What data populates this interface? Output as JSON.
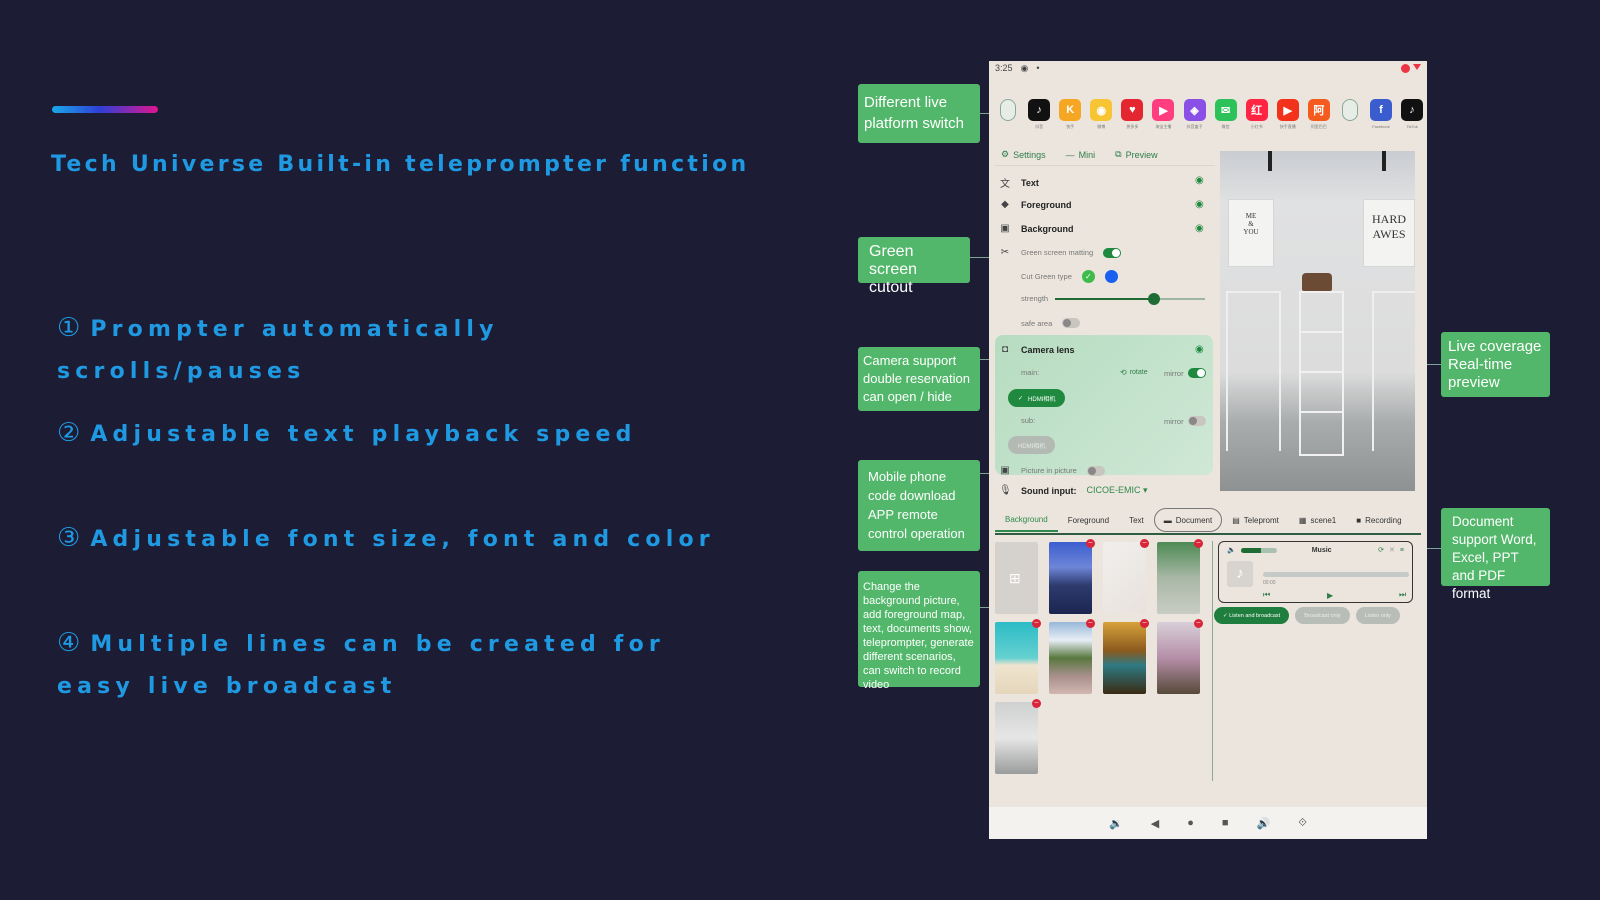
{
  "slide": {
    "title": "Tech Universe Built-in teleprompter function",
    "accent_gradient": [
      "#19a9ea",
      "#2e3fd6",
      "#e0158e"
    ],
    "text_color": "#1f9ae2",
    "background": "#1c1c35",
    "features": [
      {
        "num": "①",
        "text": "Prompter automatically scrolls/pauses"
      },
      {
        "num": "②",
        "text": "Adjustable text playback speed"
      },
      {
        "num": "③",
        "text": "Adjustable font size, font and color"
      },
      {
        "num": "④",
        "text": "Multiple lines can be created for easy live broadcast"
      }
    ]
  },
  "callouts": {
    "platform": "Different live platform switch",
    "green": "Green screen cutout",
    "camera": "Camera support double reservation can open / hide",
    "mobile": "Mobile phone code download APP remote control operation",
    "change": "Change the background picture, add foreground map, text, documents show, teleprompter, generate different scenarios, can switch to record video",
    "preview": "Live coverage Real-time preview",
    "document": "Document support Word, Excel, PPT and PDF format",
    "color": "#52b76a"
  },
  "app": {
    "status_time": "3:25",
    "platforms": [
      {
        "name": "custom-1",
        "label": "",
        "color": "pill",
        "glyph": "Other"
      },
      {
        "name": "douyin",
        "label": "抖音",
        "color": "#111111",
        "glyph": "♪"
      },
      {
        "name": "kuaishou",
        "label": "快手",
        "color": "#f5a623",
        "glyph": "K"
      },
      {
        "name": "weibo",
        "label": "微博",
        "color": "#f7c533",
        "glyph": "◉"
      },
      {
        "name": "pinduoduo",
        "label": "拼多多",
        "color": "#e3262f",
        "glyph": "♥"
      },
      {
        "name": "taobao-live",
        "label": "淘宝主播",
        "color": "#ff3d7f",
        "glyph": "▶"
      },
      {
        "name": "douyin-box",
        "label": "抖音盒子",
        "color": "#8a4fe6",
        "glyph": "◈"
      },
      {
        "name": "wechat",
        "label": "微信",
        "color": "#2dc15a",
        "glyph": "✉"
      },
      {
        "name": "xiaohongshu",
        "label": "小红书",
        "color": "#ff2442",
        "glyph": "红"
      },
      {
        "name": "kuaishou-live",
        "label": "快手直播",
        "color": "#f2321b",
        "glyph": "▶"
      },
      {
        "name": "aliexpress",
        "label": "阿里巴巴",
        "color": "#f55a1f",
        "glyph": "阿"
      },
      {
        "name": "custom-2",
        "label": "",
        "color": "pill",
        "glyph": "Other"
      },
      {
        "name": "facebook",
        "label": "Facebook",
        "color": "#3b5ccf",
        "glyph": "f"
      },
      {
        "name": "tiktok",
        "label": "TikTok",
        "color": "#111111",
        "glyph": "♪"
      }
    ],
    "toolbar": {
      "settings": "Settings",
      "mini": "Mini",
      "preview": "Preview"
    },
    "layers": {
      "text": "Text",
      "foreground": "Foreground",
      "background": "Background"
    },
    "green_screen": {
      "label": "Green screen matting",
      "enabled": true,
      "cut_type_label": "Cut Green type",
      "cut_colors": [
        "#3dbb4b",
        "#1a5ff0"
      ],
      "selected_cut": 0,
      "strength_label": "strength",
      "strength": 0.66,
      "safe_area_label": "safe area",
      "safe_area": false
    },
    "camera": {
      "label": "Camera lens",
      "main_label": "main:",
      "rotate": "rotate",
      "mirror": "mirror",
      "main_mirror": true,
      "main_device": "HDMI相机",
      "sub_label": "sub:",
      "sub_mirror": false,
      "sub_device": "HDMI相机"
    },
    "pip": {
      "label": "Picture in picture",
      "enabled": false
    },
    "sound": {
      "label": "Sound input:",
      "value": "CICOE-EMIC"
    },
    "tabs": [
      {
        "label": "Background",
        "icon": "",
        "state": "active"
      },
      {
        "label": "Foreground",
        "icon": "",
        "state": ""
      },
      {
        "label": "Text",
        "icon": "",
        "state": ""
      },
      {
        "label": "Document",
        "icon": "▬",
        "state": "outlined"
      },
      {
        "label": "Telepromt",
        "icon": "▤",
        "state": ""
      },
      {
        "label": "scene1",
        "icon": "▦",
        "state": ""
      },
      {
        "label": "Recording",
        "icon": "■",
        "state": ""
      }
    ],
    "music": {
      "title": "Music",
      "volume": 0.55,
      "time": "00:00",
      "progress": 0
    },
    "audio_buttons": {
      "listen_broadcast": "Listen and broadcast",
      "broadcast_only": "Broadcast only",
      "listen_only": "Listen only"
    },
    "thumbnails": [
      {
        "name": "add-image",
        "bg": "#d5d1cc"
      },
      {
        "name": "night-city",
        "bg": "linear-gradient(180deg,#3c5ecf 0%,#6e86d8 35%,#2d3b6e 60%,#1c2550 100%)"
      },
      {
        "name": "keychains",
        "bg": "linear-gradient(135deg,#f1efed,#e8e2dd)"
      },
      {
        "name": "green-interior",
        "bg": "linear-gradient(180deg,#4d8a54 0%,#a9b8a6 50%,#c8ccc4 100%)"
      },
      {
        "name": "beach",
        "bg": "linear-gradient(180deg,#2bbcc6 0%,#66d0d0 50%,#efe4cf 60%,#e5d6bb 100%)"
      },
      {
        "name": "mountain-road",
        "bg": "linear-gradient(180deg,#97b7d8 0%,#e7eef6 25%,#58783f 50%,#a88f8c 75%,#d2b7b1 100%)"
      },
      {
        "name": "autumn-river",
        "bg": "linear-gradient(180deg,#d7a23a 0%,#8b5a1e 40%,#2e7a84 60%,#3a2a12 100%)"
      },
      {
        "name": "cherry-blossom",
        "bg": "linear-gradient(180deg,#d9cfd8 0%,#b58fa8 50%,#574a3a 100%)"
      },
      {
        "name": "store-room",
        "bg": "linear-gradient(180deg,#cfd0d0 0%,#e6e6e6 50%,#9a9c9c 100%)"
      }
    ],
    "nav": [
      "vol-down",
      "back",
      "home",
      "recents",
      "vol-up",
      "rotate"
    ]
  }
}
